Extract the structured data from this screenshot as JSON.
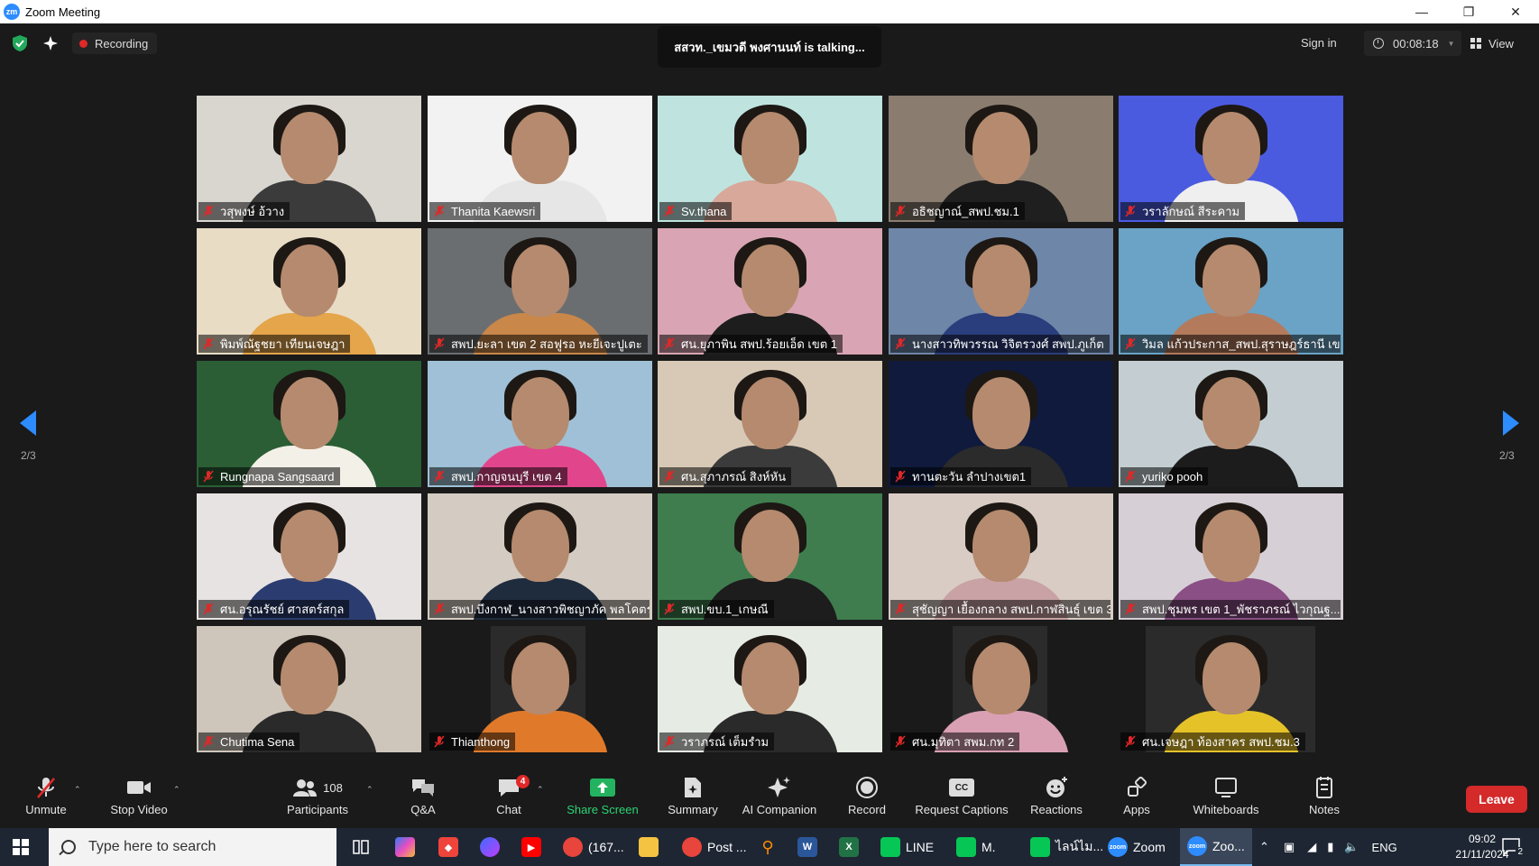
{
  "window": {
    "title": "Zoom Meeting",
    "logo_text": "zm"
  },
  "topbar": {
    "recording_label": "Recording",
    "talking_text": "สสวท._เขมวดี พงศานนท์ is  talking...",
    "sign_in": "Sign in",
    "timer": "00:08:18",
    "view_label": "View"
  },
  "pager": {
    "left": "2/3",
    "right": "2/3"
  },
  "participants": [
    {
      "name": "วสุพงษ์ อ้วาง",
      "bg": "#d9d6d0",
      "shirt": "#3b3b3b"
    },
    {
      "name": "Thanita Kaewsri",
      "bg": "#f2f2f2",
      "shirt": "#e6e6e6"
    },
    {
      "name": "Sv.thana",
      "bg": "#bfe4e0",
      "shirt": "#d8a89a"
    },
    {
      "name": "อธิชญาณ์_สพป.ชม.1",
      "bg": "#8a7d70",
      "shirt": "#1f1f1f"
    },
    {
      "name": "วราลักษณ์ สีระคาม",
      "bg": "#4b5be0",
      "shirt": "#efefef"
    },
    {
      "name": "พิมพ์ณัฐชยา เทียนเจษฎา",
      "bg": "#e8dcc5",
      "shirt": "#e4a54b"
    },
    {
      "name": "สพป.ยะลา เขต 2 สอฟูรอ หะยีเจะปูเตะ",
      "bg": "#6b6e70",
      "shirt": "#c9874a"
    },
    {
      "name": "ศน.ยุภาพิน สพป.ร้อยเอ็ด เขต 1",
      "bg": "#d9a5b4",
      "shirt": "#1d1d1d"
    },
    {
      "name": "นางสาวทิพวรรณ วิจิตรวงศ์ สพป.ภูเก็ต",
      "bg": "#6e86a8",
      "shirt": "#2a3d7c"
    },
    {
      "name": "วิมล แก้วประกาส_สพป.สุราษฎร์ธานี เข...",
      "bg": "#6aa3c6",
      "shirt": "#b47a5c"
    },
    {
      "name": "Rungnapa Sangsaard",
      "bg": "#2b5e35",
      "shirt": "#f3f0e8"
    },
    {
      "name": "สพป.กาญจนบุรี เขต 4",
      "bg": "#9fc0d6",
      "shirt": "#e1468d"
    },
    {
      "name": "ศน.สุภาภรณ์ สิงห์หัน",
      "bg": "#d8c9b6",
      "shirt": "#3b3b3b"
    },
    {
      "name": "ทานตะวัน ลำปางเขต1",
      "bg": "#0f1a3c",
      "shirt": "#2b2b2b"
    },
    {
      "name": "yuriko pooh",
      "bg": "#c4ced2",
      "shirt": "#1c1c1c"
    },
    {
      "name": "ศน.อรุณรัชย์ ศาสตร์สกุล",
      "bg": "#e8e3e3",
      "shirt": "#2b3d70"
    },
    {
      "name": "สพป.บึงกาฬ_นางสาวพิชญาภัค พลโคตร",
      "bg": "#d4ccc2",
      "shirt": "#1f2c3e"
    },
    {
      "name": "สพป.ขบ.1_เกษณี",
      "bg": "#3f7d4e",
      "shirt": "#1d1d1d"
    },
    {
      "name": "สุชัญญา เยื้องกลาง สพป.กาฬสินธุ์ เขต 3",
      "bg": "#d9ccc5",
      "shirt": "#c9a2a5"
    },
    {
      "name": "สพป.ชุมพร เขต 1_พัชราภรณ์ ไวกุณฐ...",
      "bg": "#d7cfd6",
      "shirt": "#8a4f85"
    },
    {
      "name": "Chutima Sena",
      "bg": "#cfc6bb",
      "shirt": "#2a2a2a"
    },
    {
      "name": "Thianthong",
      "bg": "#2b2b2b",
      "shirt": "#e07a2a"
    },
    {
      "name": "วราภรณ์ เต็มรำม",
      "bg": "#e6ece4",
      "shirt": "#2a2a2a"
    },
    {
      "name": "ศน.มุทิตา สพม.กท 2",
      "bg": "#2b2b2b",
      "shirt": "#d9a0b4"
    },
    {
      "name": "ศน.เจษฎา ท้องสาคร สพป.ชม.3",
      "bg": "#2b2b2b",
      "shirt": "#e6c229"
    }
  ],
  "toolbar": {
    "unmute": "Unmute",
    "stop_video": "Stop Video",
    "participants": "Participants",
    "participants_count": "108",
    "qa": "Q&A",
    "chat": "Chat",
    "chat_badge": "4",
    "share_screen": "Share Screen",
    "summary": "Summary",
    "ai_companion": "AI Companion",
    "record": "Record",
    "request_captions": "Request Captions",
    "captions_icon_text": "CC",
    "reactions": "Reactions",
    "apps": "Apps",
    "whiteboards": "Whiteboards",
    "notes": "Notes",
    "leave": "Leave"
  },
  "taskbar": {
    "search_placeholder": "Type here to search",
    "apps": [
      {
        "label": "(167...",
        "color": "#e8453c",
        "icon": "chrome-icon"
      },
      {
        "label": "Post ...",
        "color": "#e8453c",
        "icon": "chrome-icon"
      },
      {
        "label": "LINE",
        "color": "#06c755",
        "icon": "line-icon"
      },
      {
        "label": "M.",
        "color": "#06c755",
        "icon": "line-icon"
      },
      {
        "label": "ไลน์ไม...",
        "color": "#06c755",
        "icon": "line-icon"
      },
      {
        "label": "Zoom",
        "color": "#2d8cff",
        "icon": "zoom-icon"
      },
      {
        "label": "Zoo...",
        "color": "#2d8cff",
        "icon": "zoom-icon"
      }
    ],
    "lang": "ENG",
    "time": "09:02",
    "date": "21/11/2024",
    "notification_count": "2",
    "app_icon_labels": {
      "word": "W",
      "excel": "X",
      "zoom": "zoom"
    }
  }
}
